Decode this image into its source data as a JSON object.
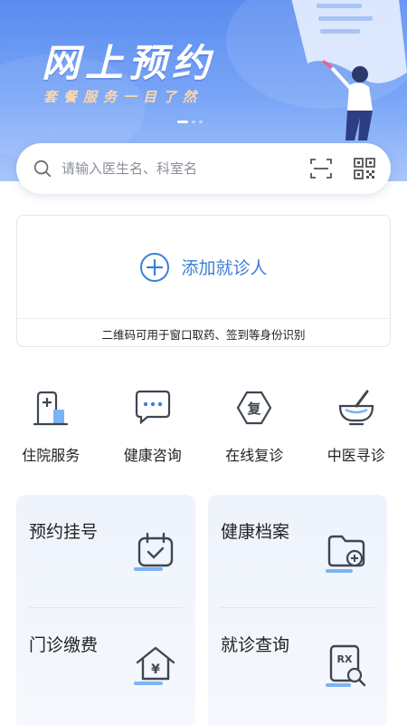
{
  "banner": {
    "title": "网上预约",
    "subtitle": "套餐服务一目了然",
    "carousel_count": 3,
    "carousel_active": 1
  },
  "search": {
    "placeholder": "请输入医生名、科室名"
  },
  "patient": {
    "add_label": "添加就诊人",
    "note": "二维码可用于窗口取药、签到等身份识别"
  },
  "quick_services": [
    {
      "label": "住院服务",
      "icon": "hospital-bed-icon"
    },
    {
      "label": "健康咨询",
      "icon": "chat-bubble-icon"
    },
    {
      "label": "在线复诊",
      "icon": "revisit-icon"
    },
    {
      "label": "中医寻诊",
      "icon": "mortar-pestle-icon"
    }
  ],
  "services": {
    "appointment": {
      "label": "预约挂号",
      "icon": "calendar-check-icon"
    },
    "payment": {
      "label": "门诊缴费",
      "icon": "house-yuan-icon"
    },
    "health_records": {
      "label": "健康档案",
      "icon": "folder-add-icon"
    },
    "visit_query": {
      "label": "就诊查询",
      "icon": "rx-search-icon"
    }
  },
  "colors": {
    "banner_top": "#5a8cf0",
    "accent": "#3b7fd8",
    "icon_dark": "#3d4653",
    "icon_light": "#7ab4f5"
  }
}
